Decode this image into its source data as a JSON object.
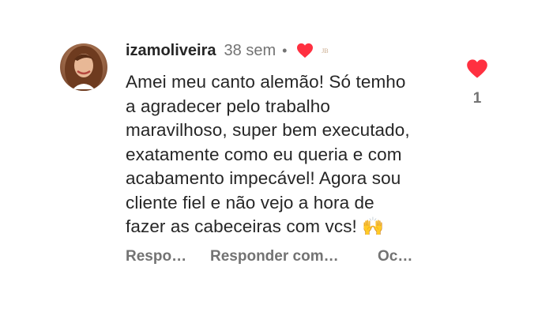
{
  "comment": {
    "username": "izamoliveira",
    "time": "38 sem",
    "separator": "•",
    "author_liked_initials": "JB",
    "text": "Amei meu canto alemão! Só temho\na agradecer pelo trabalho\nmaravilhoso, super bem executado,\nexatamente como eu queria e com\nacabamento impecável! Agora sou\ncliente fiel e não vejo a hora de\nfazer as cabeceiras com vcs! 🙌",
    "like_count": "1",
    "actions": [
      "Respo…",
      "Responder com…",
      "Oc…"
    ],
    "liked": true
  },
  "colors": {
    "heart": "#ff3040",
    "muted": "#737373",
    "text": "#262626"
  },
  "icons": {
    "avatar": "user-avatar-photo",
    "author_like": "heart-icon",
    "like": "heart-icon"
  }
}
